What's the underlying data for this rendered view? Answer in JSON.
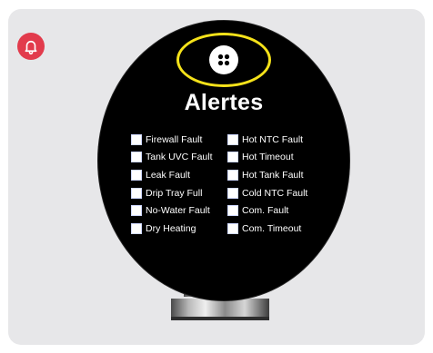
{
  "panel": {
    "title": "Alertes",
    "accent_color": "#e23b4c",
    "highlight_color": "#f5e21a",
    "alert_icon": "bell-icon",
    "menu_icon": "four-dots-icon"
  },
  "alerts": [
    {
      "label": "Firewall Fault",
      "checked": false
    },
    {
      "label": "Hot NTC Fault",
      "checked": false
    },
    {
      "label": "Tank UVC Fault",
      "checked": false
    },
    {
      "label": "Hot Timeout",
      "checked": false
    },
    {
      "label": "Leak Fault",
      "checked": false
    },
    {
      "label": "Hot Tank Fault",
      "checked": false
    },
    {
      "label": "Drip Tray Full",
      "checked": false
    },
    {
      "label": "Cold NTC Fault",
      "checked": false
    },
    {
      "label": "No-Water Fault",
      "checked": false
    },
    {
      "label": "Com. Fault",
      "checked": false
    },
    {
      "label": "Dry Heating",
      "checked": false
    },
    {
      "label": "Com. Timeout",
      "checked": false
    }
  ]
}
